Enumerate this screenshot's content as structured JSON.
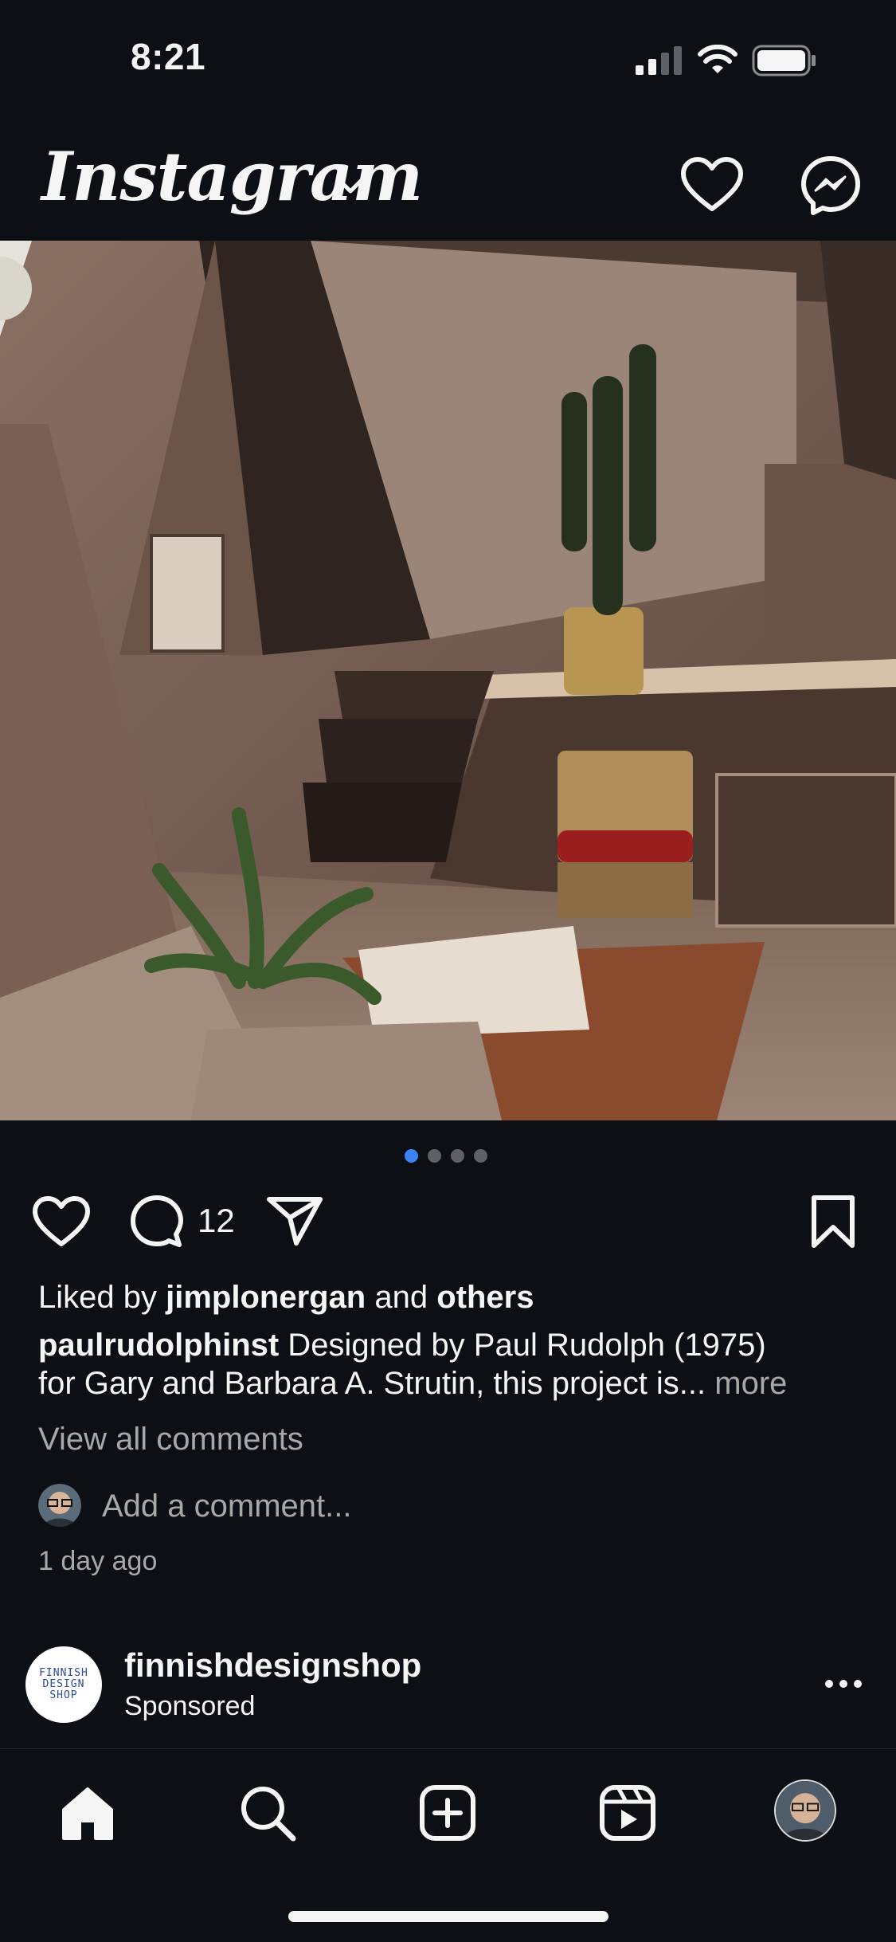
{
  "status_bar": {
    "time": "8:21"
  },
  "header": {
    "logo_text": "Instagram"
  },
  "post": {
    "carousel": {
      "total": 4,
      "active_index": 0
    },
    "comment_count": "12",
    "likes": {
      "prefix": "Liked by ",
      "user": "jimplonergan",
      "middle": " and ",
      "suffix": "others"
    },
    "caption": {
      "author": "paulrudolphinst",
      "text_line1": " Designed by Paul Rudolph (1975)",
      "text_line2": "for Gary and Barbara A. Strutin, this project is...",
      "more": " more"
    },
    "view_comments": "View all comments",
    "add_comment_placeholder": "Add a comment...",
    "time_ago": "1 day ago"
  },
  "next_post": {
    "account": "finnishdesignshop",
    "subtitle": "Sponsored",
    "avatar_text": "FINNISH\nDESIGN\nSHOP"
  },
  "tabs": [
    "home-icon",
    "search-icon",
    "create-icon",
    "reels-icon",
    "profile-avatar"
  ],
  "colors": {
    "background": "#0c1014",
    "text": "#f5f5f5",
    "muted": "#a8a8a8",
    "accent": "#3b82f6"
  }
}
